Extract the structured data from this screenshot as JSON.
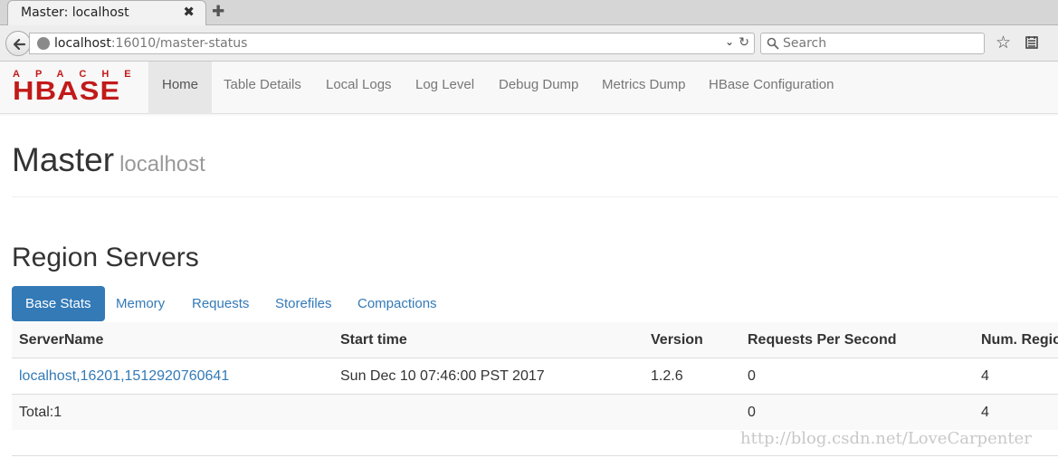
{
  "browser": {
    "tab_title": "Master: localhost",
    "tab_close": "✖",
    "new_tab": "✚",
    "url_host": "localhost",
    "url_rest": ":16010/master-status",
    "search_placeholder": "Search"
  },
  "hbase_nav": {
    "logo_top": "APACHE",
    "logo_main": "HBASE",
    "items": [
      "Home",
      "Table Details",
      "Local Logs",
      "Log Level",
      "Debug Dump",
      "Metrics Dump",
      "HBase Configuration"
    ],
    "active_index": 0
  },
  "header": {
    "title": "Master",
    "subtitle": "localhost"
  },
  "region_servers": {
    "title": "Region Servers",
    "tabs": [
      "Base Stats",
      "Memory",
      "Requests",
      "Storefiles",
      "Compactions"
    ],
    "active_tab": 0,
    "columns": [
      "ServerName",
      "Start time",
      "Version",
      "Requests Per Second",
      "Num. Regions"
    ],
    "rows": [
      [
        "localhost,16201,1512920760641",
        "Sun Dec 10 07:46:00 PST 2017",
        "1.2.6",
        "0",
        "4"
      ]
    ],
    "total_row": [
      "Total:1",
      "",
      "",
      "0",
      "4"
    ]
  },
  "watermark": "http://blog.csdn.net/LoveCarpenter",
  "colors": {
    "accent": "#337ab7",
    "logo": "#c21a1a"
  }
}
